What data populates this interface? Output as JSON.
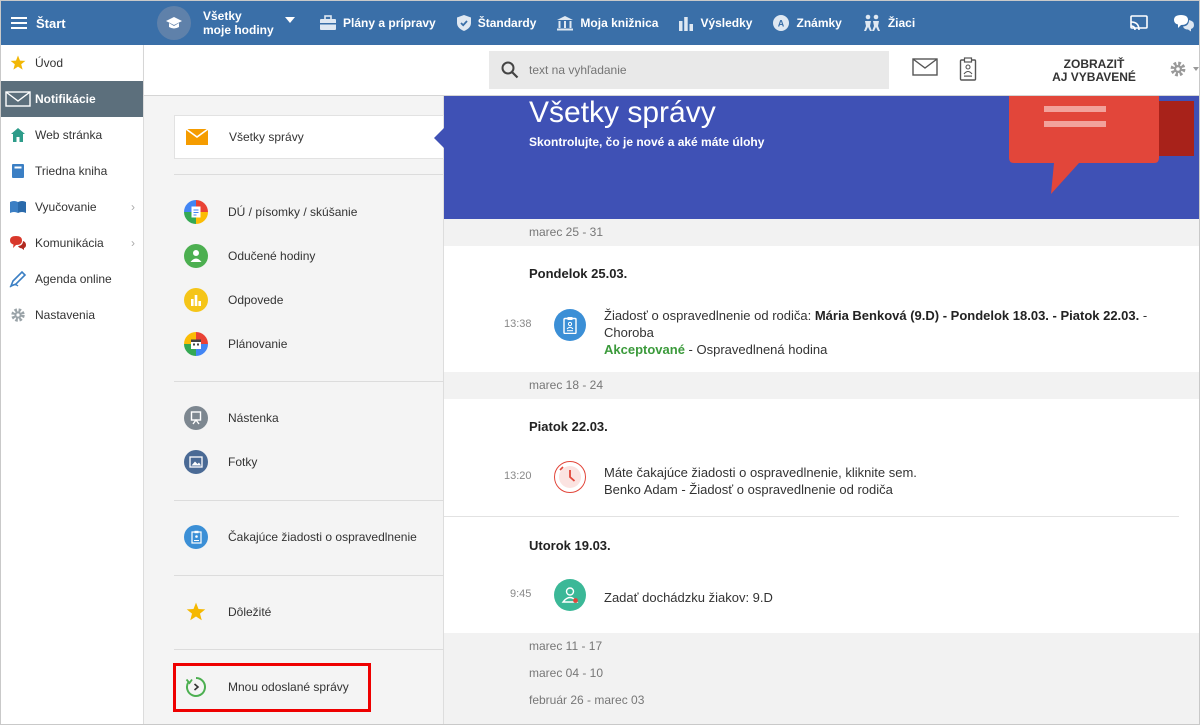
{
  "topbar": {
    "start_label": "Štart",
    "class_selector": {
      "line1": "Všetky",
      "line2": "moje hodiny"
    },
    "nav": [
      {
        "label": "Plány a prípravy",
        "icon": "briefcase-icon"
      },
      {
        "label": "Štandardy",
        "icon": "shield-icon"
      },
      {
        "label": "Moja knižnica",
        "icon": "library-icon"
      },
      {
        "label": "Výsledky",
        "icon": "bar-chart-icon"
      },
      {
        "label": "Známky",
        "icon": "grades-icon"
      },
      {
        "label": "Žiaci",
        "icon": "students-icon"
      }
    ]
  },
  "sidebar": {
    "items": [
      {
        "label": "Úvod",
        "icon": "star-icon"
      },
      {
        "label": "Notifikácie",
        "icon": "envelope-icon",
        "active": true
      },
      {
        "label": "Web stránka",
        "icon": "home-icon"
      },
      {
        "label": "Triedna kniha",
        "icon": "book-icon"
      },
      {
        "label": "Vyučovanie",
        "icon": "open-book-icon",
        "has_submenu": true
      },
      {
        "label": "Komunikácia",
        "icon": "chat-icon",
        "has_submenu": true
      },
      {
        "label": "Agenda online",
        "icon": "pen-icon"
      },
      {
        "label": "Nastavenia",
        "icon": "gear-icon"
      }
    ]
  },
  "search": {
    "placeholder": "text na vyhľadanie",
    "show_all_line1": "ZOBRAZIŤ",
    "show_all_line2": "AJ VYBAVENÉ"
  },
  "folders": [
    {
      "label": "Všetky správy",
      "icon": "envelope-icon",
      "color": "#f59c00",
      "selected": true
    },
    {
      "label": "DÚ / písomky / skúšanie",
      "icon": "homework-icon",
      "color": "#4a7fd4"
    },
    {
      "label": "Odučené hodiny",
      "icon": "person-icon",
      "color": "#4caf50"
    },
    {
      "label": "Odpovede",
      "icon": "chart-icon",
      "color": "#f5c518"
    },
    {
      "label": "Plánovanie",
      "icon": "calendar-icon",
      "color": "#555555"
    },
    {
      "label": "Nástenka",
      "icon": "board-icon",
      "color": "#7d8790"
    },
    {
      "label": "Fotky",
      "icon": "photo-icon",
      "color": "#4a6a95"
    },
    {
      "label": "Čakajúce žiadosti o ospravedlnenie",
      "icon": "clipboard-icon",
      "color": "#3b8fd6"
    },
    {
      "label": "Dôležité",
      "icon": "star-icon",
      "color": "#f5b800"
    },
    {
      "label": "Mnou odoslané správy",
      "icon": "sent-icon",
      "color": "#4caf50"
    }
  ],
  "main": {
    "title": "Všetky správy",
    "subtitle": "Skontrolujte, čo je nové a aké máte úlohy",
    "weeks": [
      "marec 25 - 31",
      "marec 18 - 24",
      "marec 11 - 17",
      "marec 04 - 10",
      "február 26 - marec 03"
    ],
    "days": [
      "Pondelok 25.03.",
      "Piatok 22.03.",
      "Utorok 19.03."
    ],
    "messages": [
      {
        "time": "13:38",
        "icon": "clipboard-icon",
        "text_prefix": "Žiadosť o ospravedlnenie od rodiča: ",
        "text_bold": "Mária Benková (9.D) - Pondelok 18.03. - Piatok 22.03.",
        "text_suffix": " - Choroba",
        "status": "Akceptované",
        "status_suffix": " - Ospravedlnená hodina"
      },
      {
        "time": "13:20",
        "icon": "clock-icon",
        "line1": "Máte čakajúce žiadosti o ospravedlnenie, kliknite sem.",
        "line2": "Benko Adam - Žiadosť o ospravedlnenie od rodiča"
      },
      {
        "time": "9:45",
        "icon": "attendance-icon",
        "line1": "Zadať dochádzku žiakov: 9.D"
      }
    ]
  },
  "colors": {
    "topbar": "#3a6fa8",
    "hero": "#3f51b5",
    "sidebar_active": "#5c6f7c",
    "accepted": "#3b9a3b",
    "highlight": "#ee0000"
  }
}
